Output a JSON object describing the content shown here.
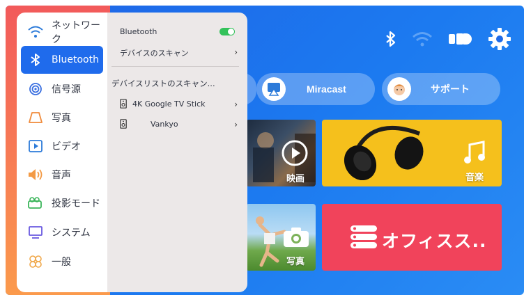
{
  "menu": {
    "items": [
      {
        "label": "ネットワーク",
        "icon": "wifi-icon"
      },
      {
        "label": "Bluetooth",
        "icon": "bluetooth-icon",
        "active": true
      },
      {
        "label": "信号源",
        "icon": "signal-source-icon"
      },
      {
        "label": "写真",
        "icon": "photo-icon"
      },
      {
        "label": "ビデオ",
        "icon": "video-icon"
      },
      {
        "label": "音声",
        "icon": "speaker-icon"
      },
      {
        "label": "投影モード",
        "icon": "projector-icon"
      },
      {
        "label": "システム",
        "icon": "monitor-icon"
      },
      {
        "label": "一般",
        "icon": "general-icon"
      }
    ]
  },
  "bluetooth_panel": {
    "bluetooth_label": "Bluetooth",
    "bluetooth_enabled": true,
    "scan_devices_label": "デバイスのスキャン",
    "device_list_label": "デバイスリストのスキャン...",
    "devices": [
      {
        "name": "4K Google TV Stick"
      },
      {
        "name": "Vankyo"
      }
    ]
  },
  "home": {
    "pills": [
      {
        "label": "Miracast",
        "icon": "miracast-icon"
      },
      {
        "label": "サポート",
        "icon": "support-icon"
      }
    ],
    "tiles": {
      "movie": "映画",
      "music": "音楽",
      "photo": "写真",
      "office": "オフィスス.."
    }
  },
  "colors": {
    "accent": "#1f6bec",
    "toggle_on": "#33c25a",
    "background_blue": "#1e64e6",
    "tile_music": "#f5c01c",
    "tile_office": "#f1435b"
  }
}
